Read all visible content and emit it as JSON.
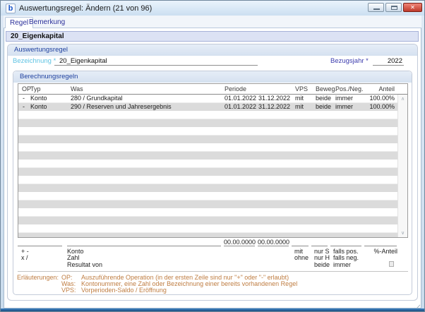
{
  "window": {
    "icon_letter": "b",
    "title": "Auswertungsregel: Ändern (21 von 96)"
  },
  "icons": {
    "close": "✕",
    "scroll_up": "∧",
    "scroll_down": "∨"
  },
  "tabs": {
    "regel": "Regel",
    "bemerkung": "Bemerkung"
  },
  "rule_name_header": "20_Eigenkapital",
  "auswertungsregel": {
    "group_title": "Auswertungsregel",
    "bezeichnung_label": "Bezeichnung *",
    "bezeichnung_value": "20_Eigenkapital",
    "bezugsjahr_label": "Bezugsjahr *",
    "bezugsjahr_value": "2022"
  },
  "berechnungsregeln": {
    "group_title": "Berechnungsregeln",
    "table": {
      "headers": {
        "op": "OP",
        "typ": "Typ",
        "was": "Was",
        "periode": "Periode",
        "vps": "VPS",
        "beweg": "Beweg.",
        "posneg": "Pos./Neg.",
        "anteil": "Anteil"
      },
      "rows": [
        {
          "op": "-",
          "typ": "Konto",
          "was": "280 / Grundkapital",
          "von": "01.01.2022",
          "bis": "31.12.2022",
          "vps": "mit",
          "beweg": "beide",
          "posneg": "immer",
          "anteil": "100.00%"
        },
        {
          "op": "-",
          "typ": "Konto",
          "was": "290 / Reserven und Jahresergebnis",
          "von": "01.01.2022",
          "bis": "31.12.2022",
          "vps": "mit",
          "beweg": "beide",
          "posneg": "immer",
          "anteil": "100.00%"
        }
      ]
    },
    "entry": {
      "von_value": "00.00.0000",
      "bis_value": "00.00.0000"
    },
    "legend": {
      "op_line1": "+ -",
      "op_line2": "x /",
      "was_line1": "Konto",
      "was_line2": "Zahl",
      "was_line3": "Resultat von",
      "vps_line1": "mit",
      "vps_line2": "ohne",
      "beweg_line1": "nur S",
      "beweg_line2": "nur H",
      "beweg_line3": "beide",
      "posneg_line1": "falls pos.",
      "posneg_line2": "falls neg.",
      "posneg_line3": "immer",
      "anteil_line1": "%-Anteil"
    },
    "erlaeuterungen": {
      "label": "Erläuterungen:",
      "op_key": "OP:",
      "op_text": "Auszuführende Operation (in der ersten Zeile sind nur \"+\" oder \"-\" erlaubt)",
      "was_key": "Was:",
      "was_text": "Kontonummer, eine Zahl oder Bezeichnung einer bereits vorhandenen Regel",
      "vps_key": "VPS:",
      "vps_text": "Vorperioden-Saldo / Eröffnung"
    }
  },
  "colors": {
    "label_cyan": "#5fc3e3",
    "label_navy": "#3c3cae",
    "note_orange": "#bf7d42",
    "close_red": "#bf3a2b",
    "group_header_bg": "#d5e1f0",
    "rule_bar_bg": "#dce2f4"
  }
}
